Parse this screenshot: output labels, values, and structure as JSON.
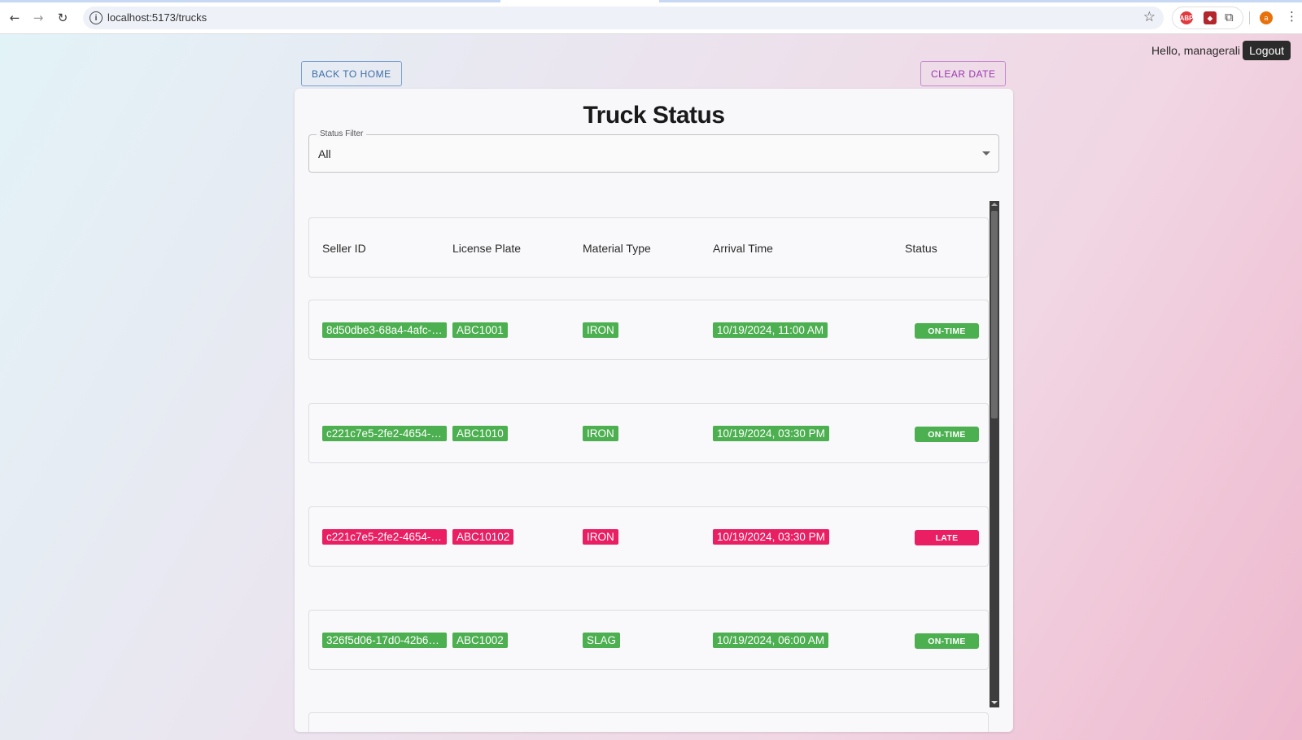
{
  "browser": {
    "url": "localhost:5173/trucks"
  },
  "header": {
    "greeting": "Hello, managerali",
    "logout_label": "Logout"
  },
  "actions": {
    "back_home_label": "BACK TO HOME",
    "clear_date_label": "CLEAR DATE"
  },
  "page_title": "Truck Status",
  "filter": {
    "label": "Status Filter",
    "value": "All"
  },
  "table": {
    "columns": [
      "Seller ID",
      "License Plate",
      "Material Type",
      "Arrival Time",
      "Status"
    ],
    "rows": [
      {
        "seller_id": "8d50dbe3-68a4-4afc-…",
        "license_plate": "ABC1001",
        "material_type": "IRON",
        "arrival_time": "10/19/2024, 11:00 AM",
        "status": "ON-TIME"
      },
      {
        "seller_id": "c221c7e5-2fe2-4654-…",
        "license_plate": "ABC1010",
        "material_type": "IRON",
        "arrival_time": "10/19/2024, 03:30 PM",
        "status": "ON-TIME"
      },
      {
        "seller_id": "c221c7e5-2fe2-4654-…",
        "license_plate": "ABC10102",
        "material_type": "IRON",
        "arrival_time": "10/19/2024, 03:30 PM",
        "status": "LATE"
      },
      {
        "seller_id": "326f5d06-17d0-42b6-…",
        "license_plate": "ABC1002",
        "material_type": "SLAG",
        "arrival_time": "10/19/2024, 06:00 AM",
        "status": "ON-TIME"
      }
    ]
  },
  "colors": {
    "on_time": "#4caf50",
    "late": "#e91e63"
  }
}
